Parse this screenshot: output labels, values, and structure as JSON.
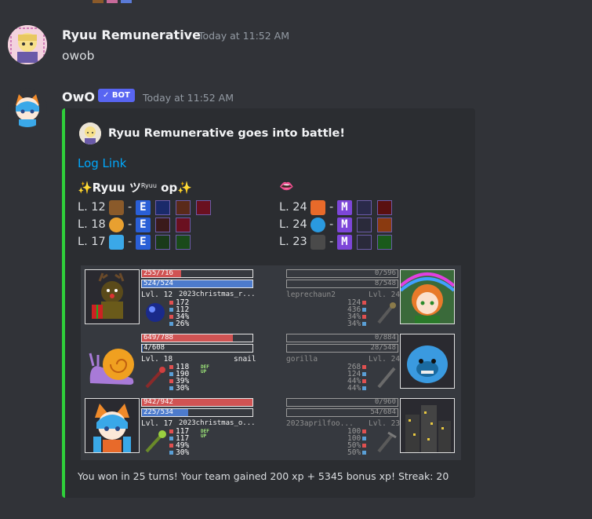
{
  "messages": [
    {
      "username": "Ryuu Remunerative",
      "timestamp": "Today at 11:52 AM",
      "content": "owob"
    },
    {
      "username": "OwO",
      "timestamp": "Today at 11:52 AM",
      "bot_badge": "BOT",
      "verified": true
    }
  ],
  "embed": {
    "author": "Ryuu Remunerative goes into battle!",
    "link": "Log Link",
    "accent_color": "#2fcf3a",
    "team_left": {
      "title_main": "✨Ryuu ツ",
      "title_sup": "Ryuu",
      "title_end": " op✨",
      "rows": [
        {
          "level": "L. 12",
          "sep": "-",
          "grade": "E"
        },
        {
          "level": "L. 18",
          "sep": "-",
          "grade": "E"
        },
        {
          "level": "L. 17",
          "sep": "-",
          "grade": "E"
        }
      ]
    },
    "team_right": {
      "title": "👄",
      "rows": [
        {
          "level": "L. 24",
          "sep": "-",
          "grade": "M"
        },
        {
          "level": "L. 24",
          "sep": "-",
          "grade": "M"
        },
        {
          "level": "L. 23",
          "sep": "-",
          "grade": "M"
        }
      ]
    },
    "battle": {
      "left": [
        {
          "hp": "255/716",
          "hp_frac": 0.356,
          "wp": "524/524",
          "wp_frac": 1.0,
          "level": "Lvl. 12",
          "name": "2023christmas_r...",
          "stats": [
            "172",
            "112",
            "34%",
            "26%"
          ]
        },
        {
          "hp": "649/788",
          "hp_frac": 0.824,
          "wp": "4/608",
          "wp_frac": 0.007,
          "level": "Lvl. 18",
          "name": "snail",
          "stats": [
            "118",
            "190",
            "39%",
            "30%"
          ],
          "buff": "DEF UP"
        },
        {
          "hp": "942/942",
          "hp_frac": 1.0,
          "wp": "225/534",
          "wp_frac": 0.421,
          "level": "Lvl. 17",
          "name": "2023christmas_o...",
          "stats": [
            "117",
            "117",
            "49%",
            "30%"
          ],
          "buff": "DEF UP"
        }
      ],
      "right": [
        {
          "hp": "0/596",
          "wp": "8/548",
          "level": "Lvl. 24",
          "name": "leprechaun2",
          "stats": [
            "124",
            "436",
            "34%",
            "34%"
          ]
        },
        {
          "hp": "0/884",
          "wp": "28/548",
          "level": "Lvl. 24",
          "name": "gorilla",
          "stats": [
            "268",
            "124",
            "44%",
            "44%"
          ]
        },
        {
          "hp": "0/960",
          "wp": "54/684",
          "level": "Lvl. 23",
          "name": "2023aprilfoo...",
          "stats": [
            "100",
            "100",
            "50%",
            "50%"
          ]
        }
      ]
    },
    "footer": "You won in 25 turns! Your team gained 200 xp + 5345 bonus xp! Streak: 20"
  },
  "colors": {
    "hp_fill": "#d05353",
    "wp_fill": "#4d7bcc",
    "stat_red": "#e05050",
    "stat_blue": "#5a9fd6",
    "grade_e": "#2a5fd6",
    "grade_m": "#7d46d8"
  }
}
